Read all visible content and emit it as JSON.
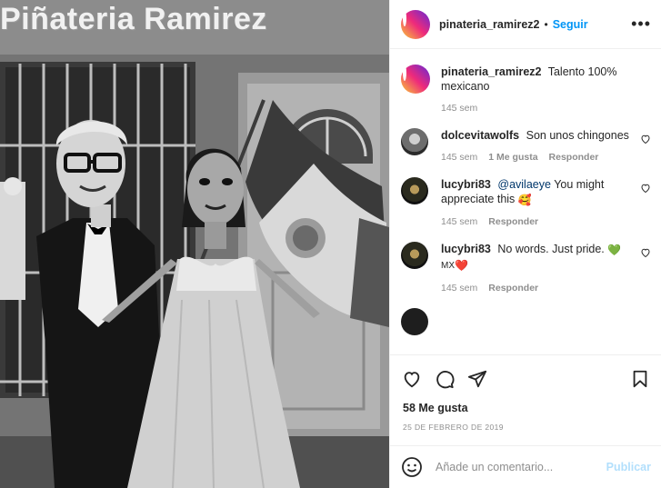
{
  "post": {
    "username": "pinateria_ramirez2",
    "follow_label": "Seguir",
    "separator": "•",
    "more_label": "•••"
  },
  "photo": {
    "sign_text": "Piñateria Ramirez"
  },
  "caption": {
    "username": "pinateria_ramirez2",
    "text": "Talento 100% mexicano",
    "time": "145 sem"
  },
  "comments": [
    {
      "username": "dolcevitawolfs",
      "text": "Son unos chingones",
      "time": "145 sem",
      "likes": "1 Me gusta",
      "reply": "Responder"
    },
    {
      "username": "lucybri83",
      "mention": "@avilaeye",
      "text": "You might appreciate this",
      "emoji": "🥰",
      "time": "145 sem",
      "reply": "Responder"
    },
    {
      "username": "lucybri83",
      "text": "No words. Just pride.",
      "emoji": "💚",
      "text2": "MX",
      "emoji2": "❤️",
      "time": "145 sem",
      "reply": "Responder"
    }
  ],
  "footer": {
    "likes": "58 Me gusta",
    "date": "25 DE FEBRERO DE 2019"
  },
  "add_comment": {
    "placeholder": "Añade un comentario...",
    "publish_label": "Publicar"
  },
  "colors": {
    "accent": "#0095f6",
    "publish_disabled": "#b2dffc",
    "secondary_text": "#8e8e8e",
    "heart_green": "#2db300",
    "heart_red": "#ed4956"
  },
  "icons": [
    "more-icon",
    "heart-icon",
    "comment-icon",
    "share-icon",
    "bookmark-icon",
    "emoji-icon"
  ]
}
